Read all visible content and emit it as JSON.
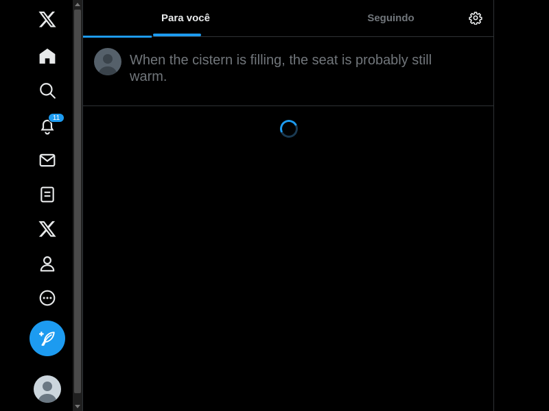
{
  "nav": {
    "items": [
      {
        "name": "x-logo",
        "icon": "x-logo-icon"
      },
      {
        "name": "home",
        "icon": "home-icon"
      },
      {
        "name": "explore",
        "icon": "search-icon"
      },
      {
        "name": "notifications",
        "icon": "bell-icon",
        "badge": "11"
      },
      {
        "name": "messages",
        "icon": "mail-icon"
      },
      {
        "name": "lists",
        "icon": "list-icon"
      },
      {
        "name": "premium",
        "icon": "x-icon"
      },
      {
        "name": "profile",
        "icon": "person-icon"
      },
      {
        "name": "more",
        "icon": "more-circle-icon"
      }
    ],
    "compose_icon": "feather-plus-icon",
    "avatar": "default-avatar"
  },
  "header": {
    "tabs": [
      {
        "label": "Para você",
        "active": true
      },
      {
        "label": "Seguindo",
        "active": false
      }
    ],
    "settings_icon": "gear-icon"
  },
  "composer": {
    "placeholder": "When the cistern is filling, the seat is probably still warm."
  },
  "feed": {
    "state": "loading"
  },
  "colors": {
    "accent": "#1d9bf0",
    "background": "#000000",
    "border": "#2f3336",
    "muted_text": "#71767b",
    "primary_text": "#e7e9ea"
  }
}
